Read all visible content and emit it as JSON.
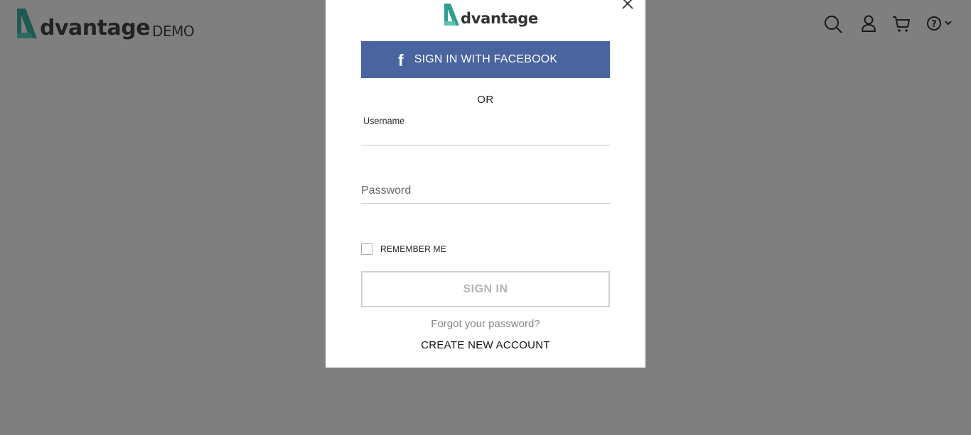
{
  "header": {
    "brand_word": "dvantage",
    "brand_demo": "DEMO",
    "icons": [
      "search-icon",
      "user-icon",
      "cart-icon",
      "help-icon"
    ]
  },
  "modal": {
    "logo_word": "dvantage",
    "facebook_icon": "f",
    "facebook_label": "SIGN IN WITH FACEBOOK",
    "or_text": "OR",
    "username_label": "Username",
    "username_value": "",
    "password_placeholder": "Password",
    "password_value": "",
    "remember_label": "REMEMBER ME",
    "remember_checked": false,
    "signin_label": "SIGN IN",
    "forgot_label": "Forgot your password?",
    "create_label": "CREATE NEW ACCOUNT"
  },
  "colors": {
    "overlay": "#7f7f7f",
    "facebook": "#4a64a0",
    "brand_teal": "#2e9e8e"
  }
}
